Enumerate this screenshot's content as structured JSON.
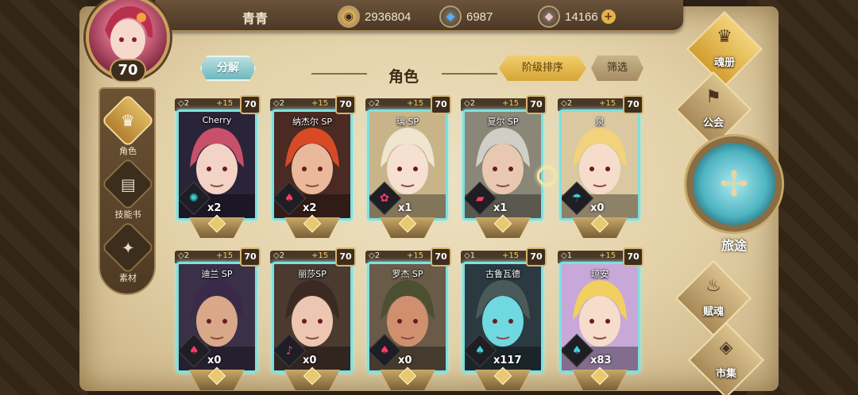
{
  "player": {
    "name": "青青",
    "level": "70"
  },
  "resources": [
    {
      "icon": "gold-coin-icon",
      "value": "2936804"
    },
    {
      "icon": "blue-crystal-icon",
      "value": "6987"
    },
    {
      "icon": "pink-gem-icon",
      "value": "14166"
    }
  ],
  "sidebar": [
    {
      "label": "角色",
      "icon": "helmet-icon",
      "active": true
    },
    {
      "label": "技能书",
      "icon": "book-icon",
      "active": false
    },
    {
      "label": "素材",
      "icon": "material-icon",
      "active": false
    }
  ],
  "toolbar": {
    "decompose": "分解",
    "title": "角色",
    "sort": "阶级排序",
    "filter": "筛选"
  },
  "cards": [
    {
      "name": "Cherry",
      "stars": "◇2",
      "plus": "+15",
      "level": "70",
      "count": "x2",
      "elem_color": "#3fd0d8",
      "elem_icon": "swirl-icon",
      "hair": "#c8506a",
      "skin": "#f3d3c6",
      "bg": "#2a2438"
    },
    {
      "name": "纳杰尔 SP",
      "stars": "◇2",
      "plus": "+15",
      "level": "70",
      "count": "x2",
      "elem_color": "#ff3a6a",
      "elem_icon": "shoe-icon",
      "hair": "#d84a26",
      "skin": "#eab89a",
      "bg": "#4a2a22"
    },
    {
      "name": "璃 SP",
      "stars": "◇2",
      "plus": "+15",
      "level": "70",
      "count": "x1",
      "elem_color": "#ff3a6a",
      "elem_icon": "rose-icon",
      "hair": "#efe6d0",
      "skin": "#f5e0d2",
      "bg": "#c9b48a"
    },
    {
      "name": "夏尔 SP",
      "stars": "◇2",
      "plus": "+15",
      "level": "70",
      "count": "x1",
      "elem_color": "#ff3a6a",
      "elem_icon": "card-icon",
      "hair": "#cfcfc8",
      "skin": "#e8c8b0",
      "bg": "#8a8678"
    },
    {
      "name": "泉",
      "stars": "◇2",
      "plus": "+15",
      "level": "70",
      "count": "x0",
      "elem_color": "#3fd0d8",
      "elem_icon": "umbrella-icon",
      "hair": "#f2d27a",
      "skin": "#f6dccb",
      "bg": "#d9c8a0"
    },
    {
      "name": "迪兰 SP",
      "stars": "◇2",
      "plus": "+15",
      "level": "70",
      "count": "x0",
      "elem_color": "#ff3a6a",
      "elem_icon": "shoe-icon",
      "hair": "#3a2a48",
      "skin": "#d8a888",
      "bg": "#3a3048"
    },
    {
      "name": "丽莎SP",
      "stars": "◇2",
      "plus": "+15",
      "level": "70",
      "count": "x0",
      "elem_color": "#ff3a6a",
      "elem_icon": "bell-icon",
      "hair": "#3a2a22",
      "skin": "#ecc6b0",
      "bg": "#4a3a30"
    },
    {
      "name": "罗杰 SP",
      "stars": "◇2",
      "plus": "+15",
      "level": "70",
      "count": "x0",
      "elem_color": "#ff3a6a",
      "elem_icon": "shoe-icon",
      "hair": "#4a5030",
      "skin": "#d09070",
      "bg": "#6a5a48"
    },
    {
      "name": "古鲁瓦德",
      "stars": "◇1",
      "plus": "+15",
      "level": "70",
      "count": "x117",
      "elem_color": "#3fd0d8",
      "elem_icon": "shoe-icon",
      "hair": "#4a5a58",
      "skin": "#6fd8e0",
      "bg": "#2a3a40"
    },
    {
      "name": "琼安",
      "stars": "◇1",
      "plus": "+15",
      "level": "70",
      "count": "x83",
      "elem_color": "#3fd0d8",
      "elem_icon": "shoe-icon",
      "hair": "#f2d060",
      "skin": "#f6dccb",
      "bg": "#c8a8d8"
    }
  ],
  "right_menu": [
    {
      "label": "魂册",
      "icon": "helmet-icon",
      "active": true
    },
    {
      "label": "公会",
      "icon": "banner-icon",
      "active": false
    },
    {
      "label": "赋魂",
      "icon": "flame-icon",
      "active": false
    },
    {
      "label": "市集",
      "icon": "gem-icon",
      "active": false
    }
  ],
  "journey": {
    "label": "旅途"
  }
}
